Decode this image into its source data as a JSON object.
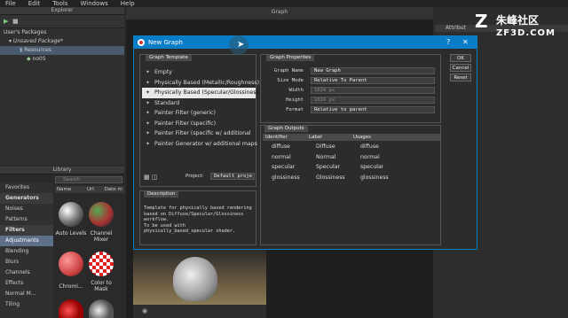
{
  "menu": [
    "File",
    "Edit",
    "Tools",
    "Windows",
    "Help"
  ],
  "panels": {
    "explorer": "Explorer",
    "graph": "Graph",
    "library": "Library",
    "attributes": "Attribut"
  },
  "explorer": {
    "users_packages": "User's Packages",
    "package": "Unsaved Package*",
    "resources": "Resources",
    "node": "no05"
  },
  "library": {
    "search_placeholder": "Search",
    "columns": [
      "Name",
      "Url",
      "Date m"
    ],
    "categories": [
      {
        "label": "Favorites",
        "kind": "item"
      },
      {
        "label": "Generators",
        "kind": "hdr"
      },
      {
        "label": "Noises",
        "kind": "item"
      },
      {
        "label": "Patterns",
        "kind": "item"
      },
      {
        "label": "Filters",
        "kind": "hdr"
      },
      {
        "label": "Adjustments",
        "kind": "sel"
      },
      {
        "label": "Blending",
        "kind": "item"
      },
      {
        "label": "Blurs",
        "kind": "item"
      },
      {
        "label": "Channels",
        "kind": "item"
      },
      {
        "label": "Effects",
        "kind": "item"
      },
      {
        "label": "Normal M...",
        "kind": "item"
      },
      {
        "label": "Tiling",
        "kind": "item"
      }
    ],
    "thumbs": [
      "Auto Levels",
      "Channel Mixer",
      "Chromi...",
      "Color to Mask"
    ]
  },
  "dialog": {
    "title": "New Graph",
    "template_group": "Graph Template",
    "templates": [
      "Empty",
      "Physically Based (Metallic/Roughness)",
      "Physically Based (Specular/Glossiness)",
      "Standard",
      "Painter Filter (generic)",
      "Painter Filter (specific)",
      "Painter Filter (specific w/ additional",
      "Painter Generator w/ additional maps"
    ],
    "selected_template_index": 2,
    "project_label": "Project:",
    "project_value": "Default proje",
    "description_title": "Description",
    "description_text": "Template for physically based rendering based on Diffuse/Specular/Glossiness workflow.\nTo be used with physically_based_specular shader.",
    "properties_title": "Graph Properties",
    "props": [
      {
        "label": "Graph Name",
        "value": "New Graph"
      },
      {
        "label": "Size Mode",
        "value": "Relative To Parent"
      },
      {
        "label": "Width",
        "value": "1024 px"
      },
      {
        "label": "Height",
        "value": "1024 px"
      },
      {
        "label": "Format",
        "value": "Relative to parent"
      }
    ],
    "outputs_title": "Graph Outputs",
    "outputs_columns": [
      "Identifier",
      "Label",
      "Usages"
    ],
    "outputs": [
      [
        "diffuse",
        "Diffuse",
        "diffuse"
      ],
      [
        "normal",
        "Normal",
        "normal"
      ],
      [
        "specular",
        "Specular",
        "specular"
      ],
      [
        "glossiness",
        "Glossiness",
        "glossiness"
      ]
    ],
    "buttons": {
      "ok": "OK",
      "cancel": "Cancel",
      "reset": "Reset"
    }
  },
  "watermark": {
    "cn": "朱峰社区",
    "url": "ZF3D.COM"
  }
}
